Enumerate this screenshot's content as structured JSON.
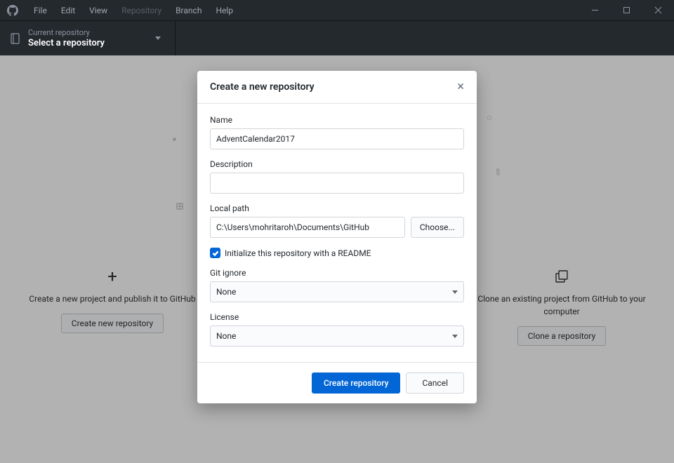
{
  "menubar": {
    "items": [
      "File",
      "Edit",
      "View",
      "Repository",
      "Branch",
      "Help"
    ],
    "disabled_index": 3
  },
  "toolbar": {
    "repo_selector": {
      "label": "Current repository",
      "value": "Select a repository"
    }
  },
  "background": {
    "left": {
      "title": "Create a new project and publish it to GitHub",
      "button": "Create new repository"
    },
    "right": {
      "title": "Clone an existing project from GitHub to your computer",
      "button": "Clone a repository"
    }
  },
  "dialog": {
    "title": "Create a new repository",
    "fields": {
      "name": {
        "label": "Name",
        "value": "AdventCalendar2017"
      },
      "description": {
        "label": "Description",
        "value": ""
      },
      "local_path": {
        "label": "Local path",
        "value": "C:\\Users\\mohritaroh\\Documents\\GitHub",
        "choose": "Choose..."
      },
      "init_readme": {
        "label": "Initialize this repository with a README",
        "checked": true
      },
      "gitignore": {
        "label": "Git ignore",
        "value": "None"
      },
      "license": {
        "label": "License",
        "value": "None"
      }
    },
    "buttons": {
      "primary": "Create repository",
      "cancel": "Cancel"
    }
  }
}
